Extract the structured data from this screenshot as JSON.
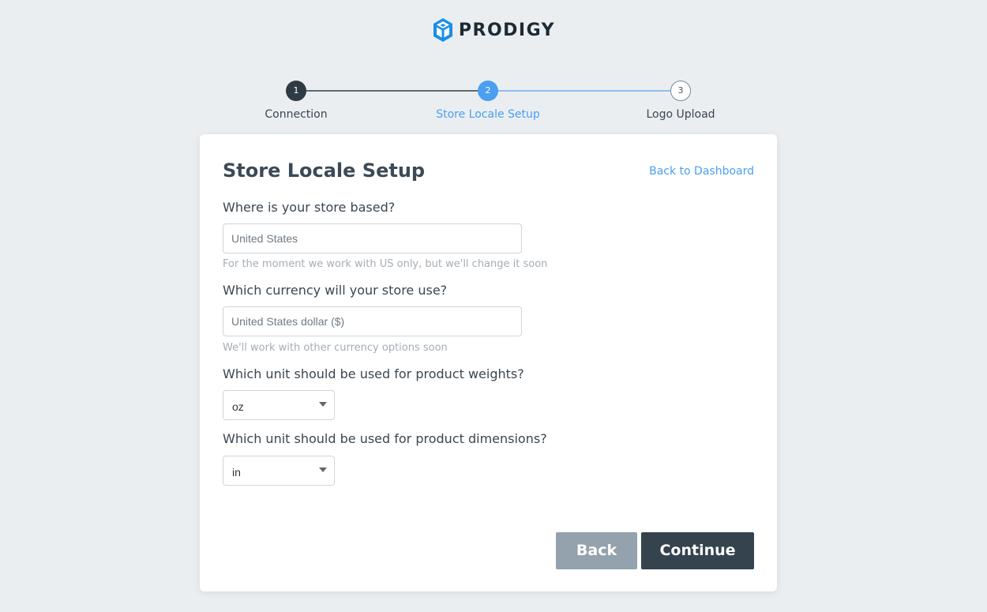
{
  "brand": {
    "name": "PRODIGY",
    "logo_icon": "cube-logo-icon",
    "logo_color": "#1a8fe8"
  },
  "stepper": {
    "steps": [
      {
        "number": "1",
        "label": "Connection",
        "state": "completed"
      },
      {
        "number": "2",
        "label": "Store Locale Setup",
        "state": "active"
      },
      {
        "number": "3",
        "label": "Logo Upload",
        "state": "pending"
      }
    ],
    "colors": {
      "completed": "#2e3b44",
      "active": "#4a9ff0",
      "pending": "#7c8790"
    }
  },
  "card": {
    "title": "Store Locale Setup",
    "back_link": "Back to Dashboard",
    "fields": {
      "country": {
        "label": "Where is your store based?",
        "placeholder": "United States",
        "value": "",
        "hint": "For the moment we work with US only, but we'll change it soon"
      },
      "currency": {
        "label": "Which currency will your store use?",
        "placeholder": "United States dollar ($)",
        "value": "",
        "hint": "We'll work with other currency options soon"
      },
      "weight_unit": {
        "label": "Which unit should be used for product weights?",
        "selected": "oz"
      },
      "dimension_unit": {
        "label": "Which unit should be used for product dimensions?",
        "selected": "in"
      }
    },
    "buttons": {
      "back": "Back",
      "continue": "Continue"
    }
  }
}
